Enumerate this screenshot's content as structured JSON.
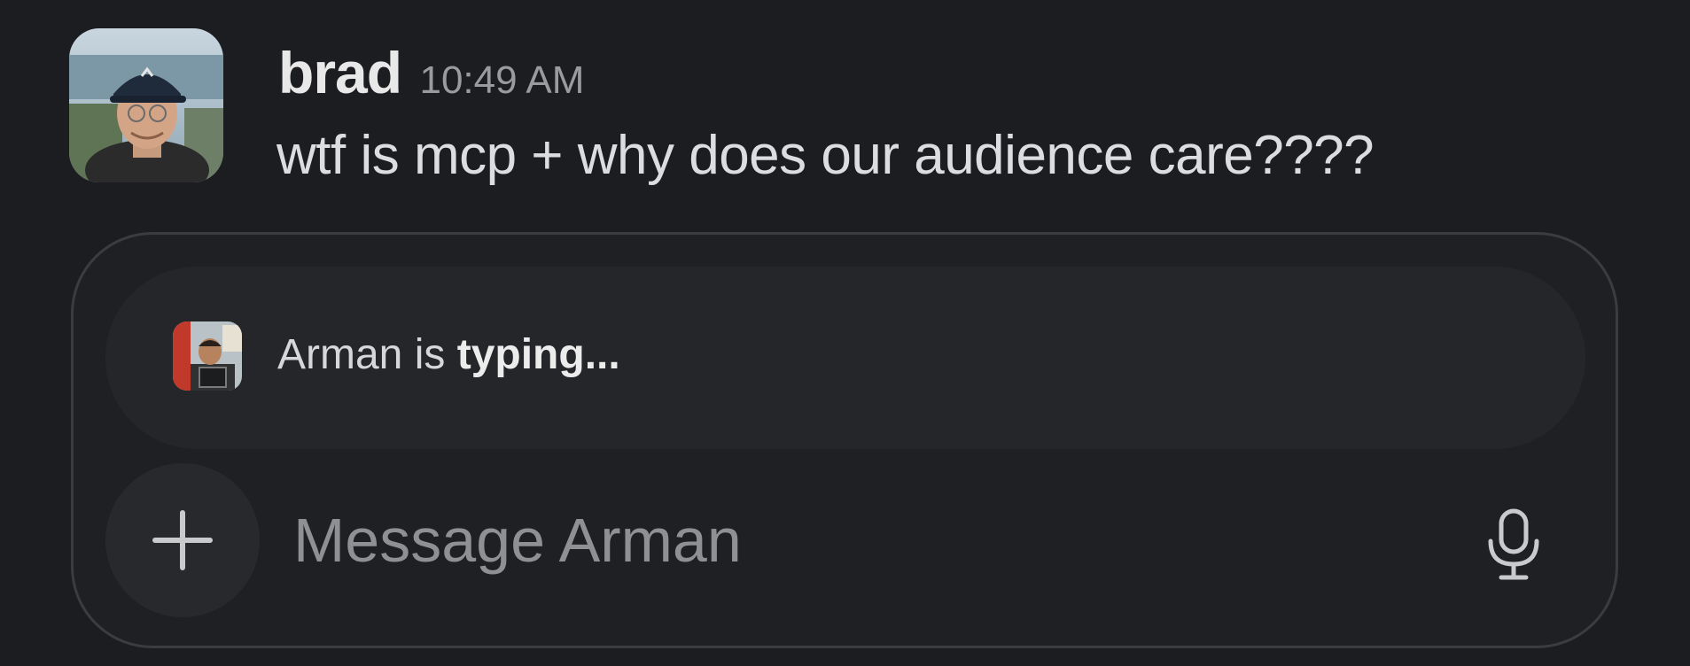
{
  "message": {
    "author": "brad",
    "timestamp": "10:49 AM",
    "text": "wtf is mcp + why does our audience care????",
    "avatar_icon": "user-avatar-photo"
  },
  "composer": {
    "typing_indicator": {
      "name": "Arman",
      "connector": " is ",
      "status": "typing...",
      "avatar_icon": "user-avatar-photo"
    },
    "add_icon": "plus-icon",
    "input_placeholder": "Message Arman",
    "mic_icon": "microphone-icon"
  },
  "colors": {
    "background": "#1b1d21",
    "composer_bg": "#1f2024",
    "typing_bar_bg": "#25262a",
    "add_button_bg": "#28292d",
    "text_primary": "#dcdddf",
    "text_muted": "#9a9b9e"
  }
}
